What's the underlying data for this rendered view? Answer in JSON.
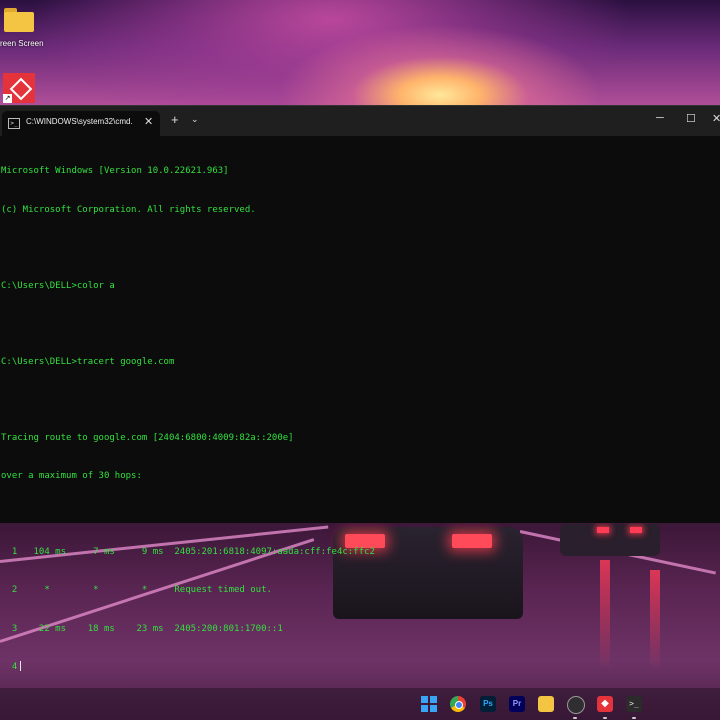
{
  "desktop": {
    "icon_label": "reen Screen"
  },
  "window": {
    "tab_title": "C:\\WINDOWS\\system32\\cmd.",
    "tab_close": "✕",
    "new_tab": "+",
    "dropdown": "⌄",
    "minimize": "─",
    "maximize": "☐",
    "close": "✕",
    "tab_icon": ">_"
  },
  "console": {
    "lines": [
      "Microsoft Windows [Version 10.0.22621.963]",
      "(c) Microsoft Corporation. All rights reserved.",
      "",
      "C:\\Users\\DELL>color a",
      "",
      "C:\\Users\\DELL>tracert google.com",
      "",
      "Tracing route to google.com [2404:6800:4009:82a::200e]",
      "over a maximum of 30 hops:",
      "",
      "  1   104 ms     7 ms     9 ms  2405:201:6818:4097:aada:cff:fe4c:ffc2",
      "  2     *        *        *     Request timed out.",
      "  3    22 ms    18 ms    23 ms  2405:200:801:1700::1",
      "  4"
    ],
    "text_color": "#33e03f",
    "background": "#0c0c0c"
  },
  "taskbar": {
    "ps_label": "Ps",
    "pr_label": "Pr",
    "anydesk_label": "◆",
    "terminal_label": ">_"
  }
}
